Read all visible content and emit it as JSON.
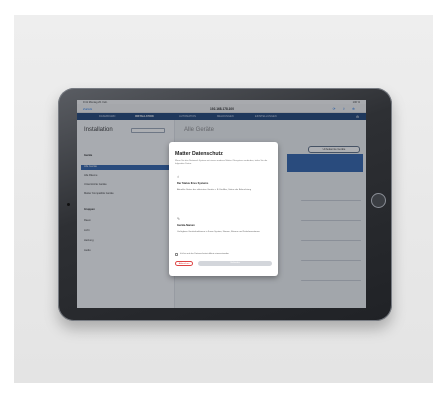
{
  "status_bar": {
    "time": "9:41 Montag 20. Feb.",
    "battery": "100 %"
  },
  "browser": {
    "url": "192.168.178.100",
    "nav": "Zurück",
    "tools": "⟳ ⇪ ⊕"
  },
  "app_tabs": [
    "DASHBOARD",
    "INSTALLATION",
    "AUTOMATION",
    "MELDUNGEN",
    "EINSTELLUNGEN"
  ],
  "sidebar": {
    "title": "Installation",
    "sections": [
      "Geräte",
      "Alle Geräte",
      "Alle Räume",
      "Unterstützte Geräte",
      "Matter Kompatible Geräte",
      "Gruppen",
      "Raum",
      "Licht",
      "Heizung",
      "Audio"
    ]
  },
  "content": {
    "title": "Alle Geräte",
    "warning_button": "Unbekannte Geräte"
  },
  "modal": {
    "title": "Matter Datenschutz",
    "intro": "Wenn Sie das Netzwerk System mit einem anderen Matter Ökosystem verbinden, teilen Sie die folgenden Daten:",
    "item1_heading": "Der Status Ihres Systems",
    "item1_text": "Aktueller Status der aktivierten Geräte z. B. Ein/Aus, Status der Beleuchtung",
    "item2_heading": "Geräte-Namen",
    "item2_text": "Verfügbare Gerätefunktionen in Ihrem System, Namen, Räume und Zeitinformationen",
    "checkbox_label": "Ich bin mit der Datenschutzrichtlinie einverstanden",
    "cancel_label": "Abbrechen",
    "accept_label": "Verbinden"
  },
  "colors": {
    "app_bar": "#1b3f73",
    "accent": "#2b5ea8",
    "cancel": "#dd4444"
  }
}
